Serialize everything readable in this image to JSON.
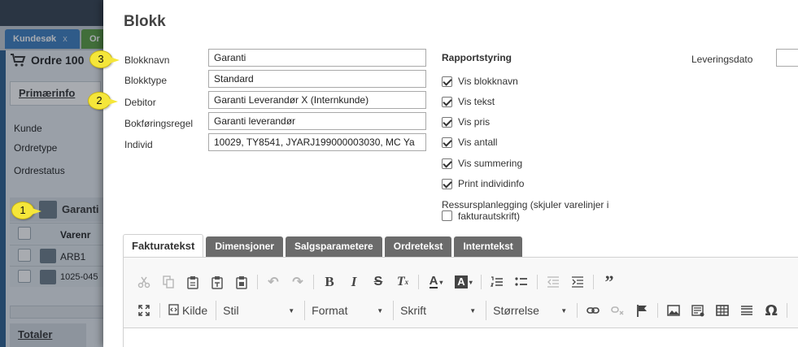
{
  "background": {
    "tabs": [
      {
        "label": "Kundesøk",
        "close": "x"
      },
      {
        "label": "Or"
      }
    ],
    "order_title": "Ordre 100",
    "primaerinfo": "Primærinfo",
    "fields": [
      "Kunde",
      "Ordretype",
      "Ordrestatus"
    ],
    "group_title": "Garanti",
    "column_header": "Varenr",
    "rows": [
      "ARB1",
      "1025-045"
    ],
    "totaler": "Totaler"
  },
  "callouts": [
    "1",
    "2",
    "3"
  ],
  "modal": {
    "title": "Blokk",
    "fields": [
      {
        "label": "Blokknavn",
        "value": "Garanti"
      },
      {
        "label": "Blokktype",
        "value": "Standard"
      },
      {
        "label": "Debitor",
        "value": "Garanti Leverandør X (Internkunde)"
      },
      {
        "label": "Bokføringsregel",
        "value": "Garanti leverandør"
      },
      {
        "label": "Individ",
        "value": "10029, TY8541, JYARJ199000003030, MC Ya"
      }
    ],
    "rapportstyring": {
      "title": "Rapportstyring",
      "options": [
        {
          "label": "Vis blokknavn",
          "checked": true
        },
        {
          "label": "Vis tekst",
          "checked": true
        },
        {
          "label": "Vis pris",
          "checked": true
        },
        {
          "label": "Vis antall",
          "checked": true
        },
        {
          "label": "Vis summering",
          "checked": true
        },
        {
          "label": "Print individinfo",
          "checked": true
        }
      ],
      "ressurs_line1": "Ressursplanlegging (skjuler varelinjer i",
      "ressurs_line2": "fakturautskrift)",
      "ressurs_checked": false
    },
    "leveringsdato": {
      "label": "Leveringsdato",
      "value": ""
    },
    "tabs": [
      {
        "label": "Fakturatekst",
        "active": true
      },
      {
        "label": "Dimensjoner",
        "active": false
      },
      {
        "label": "Salgsparametere",
        "active": false
      },
      {
        "label": "Ordretekst",
        "active": false
      },
      {
        "label": "Interntekst",
        "active": false
      }
    ],
    "editor": {
      "kilde": "Kilde",
      "combos": [
        "Stil",
        "Format",
        "Skrift",
        "Størrelse"
      ]
    }
  }
}
